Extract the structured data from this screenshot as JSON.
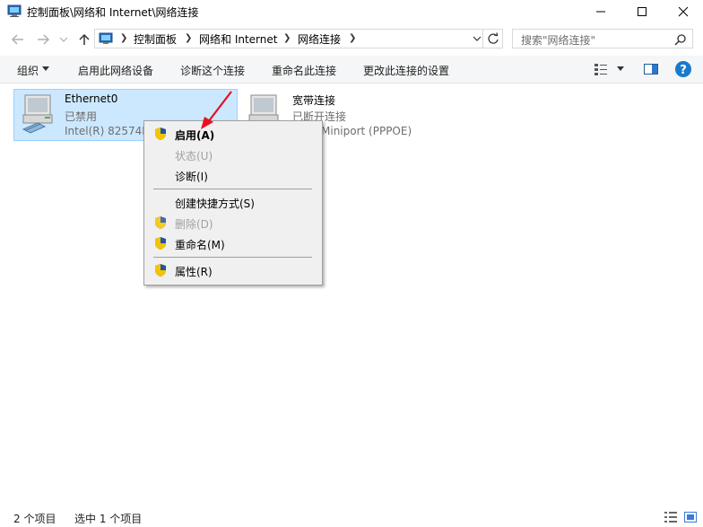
{
  "window": {
    "title": "控制面板\\网络和 Internet\\网络连接"
  },
  "address": {
    "crumbs": [
      "控制面板",
      "网络和 Internet",
      "网络连接"
    ]
  },
  "search": {
    "placeholder": "搜索\"网络连接\""
  },
  "commands": [
    {
      "label": "组织"
    },
    {
      "label": "启用此网络设备"
    },
    {
      "label": "诊断这个连接"
    },
    {
      "label": "重命名此连接"
    },
    {
      "label": "更改此连接的设置"
    }
  ],
  "items": [
    {
      "name": "Ethernet0",
      "status": "已禁用",
      "device": "Intel(R) 82574L"
    },
    {
      "name": "宽带连接",
      "status": "已断开连接",
      "device": "Miniport (PPPOE)"
    }
  ],
  "context_menu": {
    "items": [
      {
        "label": "启用(A)"
      },
      {
        "label": "状态(U)"
      },
      {
        "label": "诊断(I)"
      },
      {
        "label": "创建快捷方式(S)"
      },
      {
        "label": "删除(D)"
      },
      {
        "label": "重命名(M)"
      },
      {
        "label": "属性(R)"
      }
    ]
  },
  "status": {
    "count": "2 个项目",
    "selected": "选中 1 个项目"
  },
  "colors": {
    "selection": "#cce8ff",
    "selection_border": "#99d1ff",
    "menu_bg": "#f0f0f0",
    "arrow": "#e81123"
  }
}
